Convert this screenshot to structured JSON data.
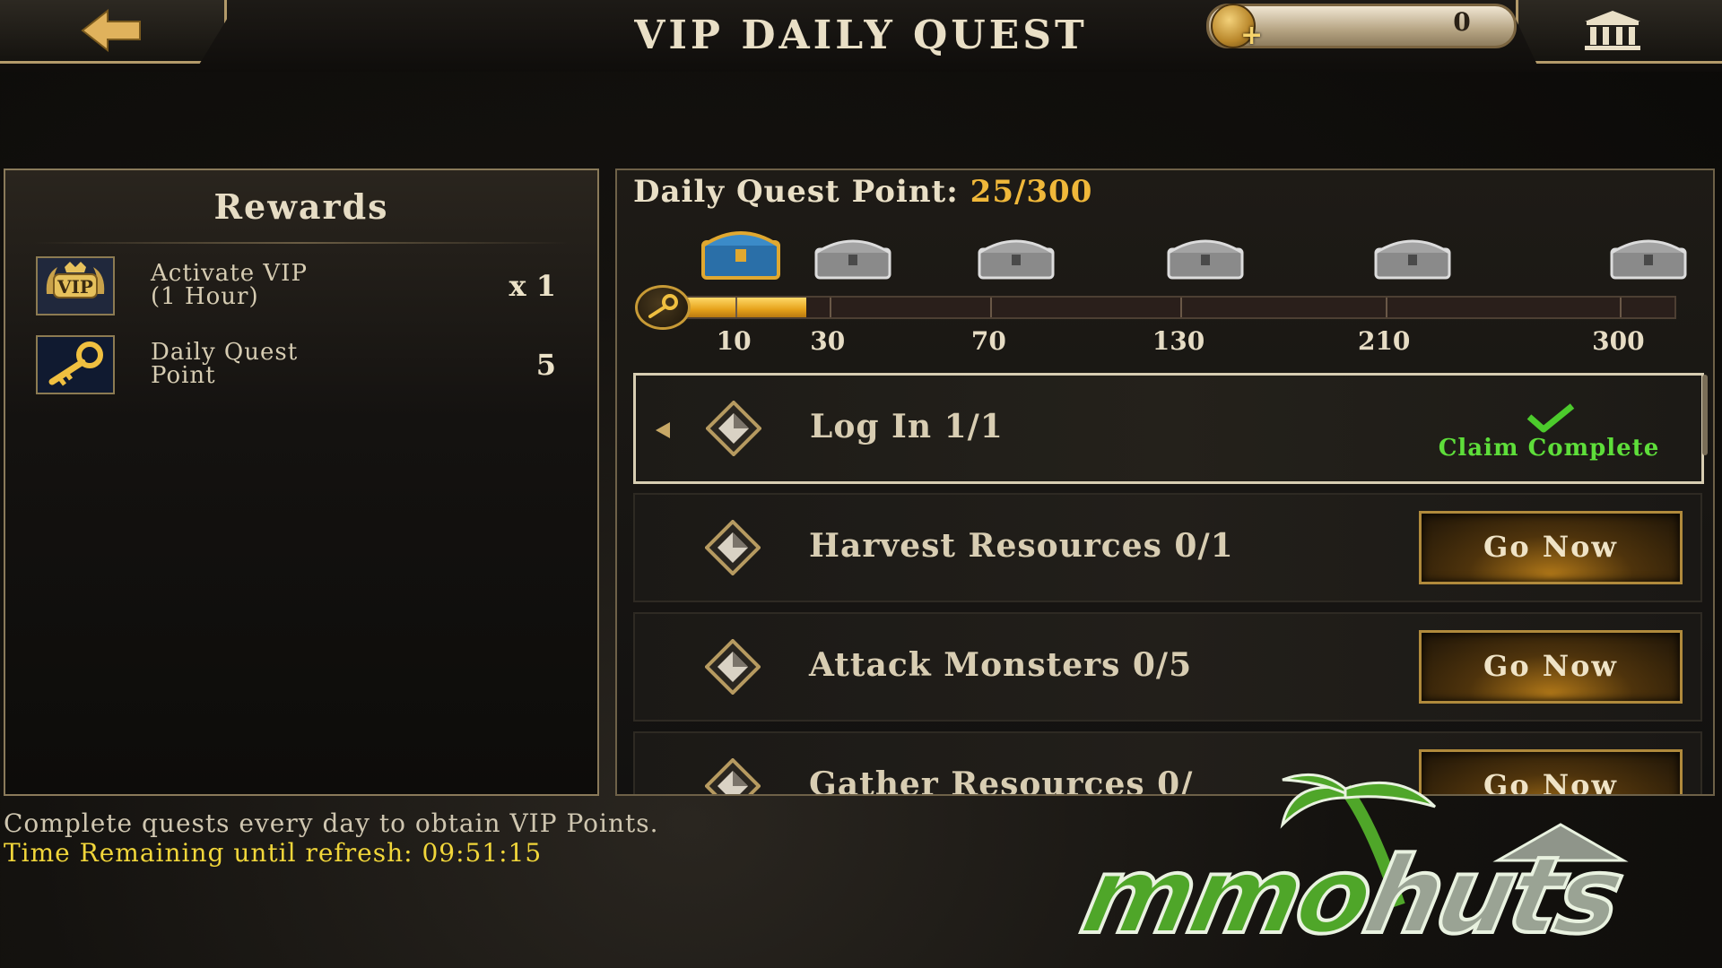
{
  "header": {
    "title": "VIP DAILY QUEST",
    "gold_amount": "0"
  },
  "rewards": {
    "title": "Rewards",
    "items": [
      {
        "icon": "vip-badge-icon",
        "name": "Activate VIP\n(1 Hour)",
        "qty": "x 1"
      },
      {
        "icon": "gold-key-icon",
        "name": "Daily Quest\nPoint",
        "qty": "5"
      }
    ]
  },
  "quest_points": {
    "label": "Daily Quest Point:",
    "value": "25/300",
    "current": 25,
    "max": 300,
    "milestones": [
      "10",
      "30",
      "70",
      "130",
      "210",
      "300"
    ]
  },
  "quests": [
    {
      "name": "Log In 1/1",
      "status": "Claim Complete"
    },
    {
      "name": "Harvest Resources 0/1",
      "button": "Go Now"
    },
    {
      "name": "Attack Monsters 0/5",
      "button": "Go Now"
    },
    {
      "name": "Gather Resources 0/",
      "button": "Go Now"
    }
  ],
  "footer": {
    "info": "Complete quests every day to obtain VIP Points.",
    "refresh": "Time Remaining until refresh: 09:51:15"
  },
  "watermark": {
    "brand_a": "mmo",
    "brand_b": "huts"
  },
  "colors": {
    "accent_gold": "#f0b83a",
    "complete_green": "#5ede3a",
    "timer_yellow": "#f1d63a"
  }
}
